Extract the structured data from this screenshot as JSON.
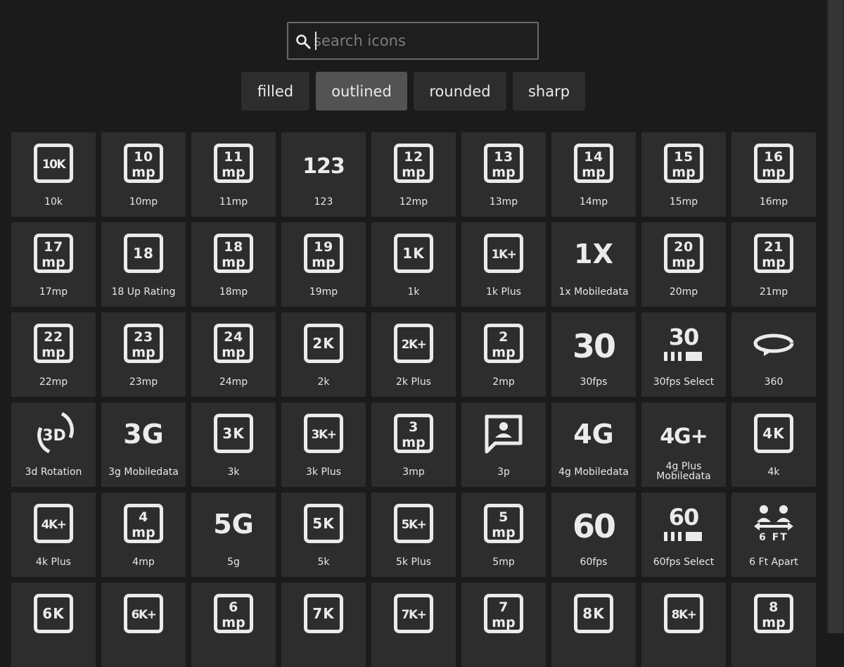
{
  "search": {
    "placeholder": "search icons",
    "value": ""
  },
  "styles": [
    {
      "label": "filled",
      "active": false
    },
    {
      "label": "outlined",
      "active": true
    },
    {
      "label": "rounded",
      "active": false
    },
    {
      "label": "sharp",
      "active": false
    }
  ],
  "colors": {
    "background": "#1b1b1b",
    "tile": "#2d2d2d",
    "active_tab": "#535353",
    "icon": "#ebebeb"
  },
  "icons": [
    {
      "label": "10k",
      "kind": "box",
      "top": "10K"
    },
    {
      "label": "10mp",
      "kind": "mp",
      "top": "10"
    },
    {
      "label": "11mp",
      "kind": "mp",
      "top": "11"
    },
    {
      "label": "123",
      "kind": "plain",
      "top": "123"
    },
    {
      "label": "12mp",
      "kind": "mp",
      "top": "12"
    },
    {
      "label": "13mp",
      "kind": "mp",
      "top": "13"
    },
    {
      "label": "14mp",
      "kind": "mp",
      "top": "14"
    },
    {
      "label": "15mp",
      "kind": "mp",
      "top": "15"
    },
    {
      "label": "16mp",
      "kind": "mp",
      "top": "16"
    },
    {
      "label": "17mp",
      "kind": "mp",
      "top": "17"
    },
    {
      "label": "18 Up Rating",
      "kind": "box",
      "top": "18"
    },
    {
      "label": "18mp",
      "kind": "mp",
      "top": "18"
    },
    {
      "label": "19mp",
      "kind": "mp",
      "top": "19"
    },
    {
      "label": "1k",
      "kind": "box",
      "top": "1K"
    },
    {
      "label": "1k Plus",
      "kind": "box",
      "top": "1K+"
    },
    {
      "label": "1x Mobiledata",
      "kind": "plain",
      "top": "1X"
    },
    {
      "label": "20mp",
      "kind": "mp",
      "top": "20"
    },
    {
      "label": "21mp",
      "kind": "mp",
      "top": "21"
    },
    {
      "label": "22mp",
      "kind": "mp",
      "top": "22"
    },
    {
      "label": "23mp",
      "kind": "mp",
      "top": "23"
    },
    {
      "label": "24mp",
      "kind": "mp",
      "top": "24"
    },
    {
      "label": "2k",
      "kind": "box",
      "top": "2K"
    },
    {
      "label": "2k Plus",
      "kind": "box",
      "top": "2K+"
    },
    {
      "label": "2mp",
      "kind": "mp",
      "top": "2"
    },
    {
      "label": "30fps",
      "kind": "big",
      "top": "30"
    },
    {
      "label": "30fps Select",
      "kind": "select",
      "top": "30"
    },
    {
      "label": "360",
      "kind": "rotate",
      "top": ""
    },
    {
      "label": "3d Rotation",
      "kind": "rot3d",
      "top": "3D"
    },
    {
      "label": "3g Mobiledata",
      "kind": "plain",
      "top": "3G"
    },
    {
      "label": "3k",
      "kind": "box",
      "top": "3K"
    },
    {
      "label": "3k Plus",
      "kind": "box",
      "top": "3K+"
    },
    {
      "label": "3mp",
      "kind": "mp",
      "top": "3"
    },
    {
      "label": "3p",
      "kind": "chat",
      "top": ""
    },
    {
      "label": "4g Mobiledata",
      "kind": "plain",
      "top": "4G"
    },
    {
      "label": "4g Plus Mobiledata",
      "kind": "plain",
      "top": "4G+"
    },
    {
      "label": "4k",
      "kind": "box",
      "top": "4K"
    },
    {
      "label": "4k Plus",
      "kind": "box",
      "top": "4K+"
    },
    {
      "label": "4mp",
      "kind": "mp",
      "top": "4"
    },
    {
      "label": "5g",
      "kind": "plain",
      "top": "5G"
    },
    {
      "label": "5k",
      "kind": "box",
      "top": "5K"
    },
    {
      "label": "5k Plus",
      "kind": "box",
      "top": "5K+"
    },
    {
      "label": "5mp",
      "kind": "mp",
      "top": "5"
    },
    {
      "label": "60fps",
      "kind": "big",
      "top": "60"
    },
    {
      "label": "60fps Select",
      "kind": "select",
      "top": "60"
    },
    {
      "label": "6 Ft Apart",
      "kind": "apart",
      "top": "6 FT"
    },
    {
      "label": "",
      "kind": "box",
      "top": "6K"
    },
    {
      "label": "",
      "kind": "box",
      "top": "6K+"
    },
    {
      "label": "",
      "kind": "mp",
      "top": "6"
    },
    {
      "label": "",
      "kind": "box",
      "top": "7K"
    },
    {
      "label": "",
      "kind": "box",
      "top": "7K+"
    },
    {
      "label": "",
      "kind": "mp",
      "top": "7"
    },
    {
      "label": "",
      "kind": "box",
      "top": "8K"
    },
    {
      "label": "",
      "kind": "box",
      "top": "8K+"
    },
    {
      "label": "",
      "kind": "mp",
      "top": "8"
    }
  ]
}
